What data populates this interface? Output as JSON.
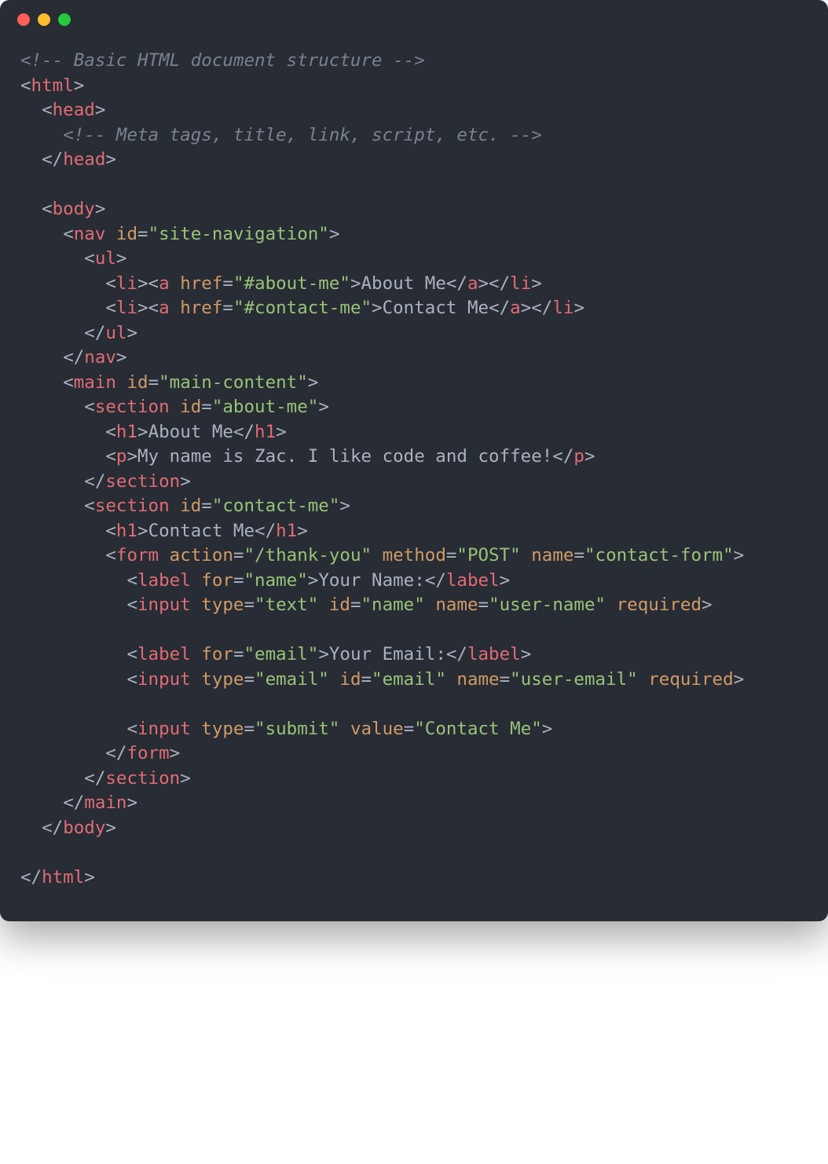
{
  "code": {
    "comment_top": "<!-- Basic HTML document structure -->",
    "tag_html": "html",
    "tag_head": "head",
    "comment_head": "<!-- Meta tags, title, link, script, etc. -->",
    "tag_body": "body",
    "tag_nav": "nav",
    "attr_id": "id",
    "nav_id": "\"site-navigation\"",
    "tag_ul": "ul",
    "tag_li": "li",
    "tag_a": "a",
    "attr_href": "href",
    "href_about": "\"#about-me\"",
    "link_about": "About Me",
    "href_contact": "\"#contact-me\"",
    "link_contact": "Contact Me",
    "tag_main": "main",
    "main_id": "\"main-content\"",
    "tag_section": "section",
    "section_about_id": "\"about-me\"",
    "tag_h1": "h1",
    "h1_about": "About Me",
    "tag_p": "p",
    "p_about": "My name is Zac. I like code and coffee!",
    "section_contact_id": "\"contact-me\"",
    "h1_contact": "Contact Me",
    "tag_form": "form",
    "attr_action": "action",
    "form_action": "\"/thank-you\"",
    "attr_method": "method",
    "form_method": "\"POST\"",
    "attr_name": "name",
    "form_name": "\"contact-form\"",
    "tag_label": "label",
    "attr_for": "for",
    "for_name": "\"name\"",
    "label_name": "Your Name:",
    "tag_input": "input",
    "attr_type": "type",
    "type_text": "\"text\"",
    "id_name": "\"name\"",
    "name_user_name": "\"user-name\"",
    "attr_required": "required",
    "for_email": "\"email\"",
    "label_email": "Your Email:",
    "type_email": "\"email\"",
    "id_email": "\"email\"",
    "name_user_email": "\"user-email\"",
    "type_submit": "\"submit\"",
    "attr_value": "value",
    "value_submit": "\"Contact Me\""
  }
}
